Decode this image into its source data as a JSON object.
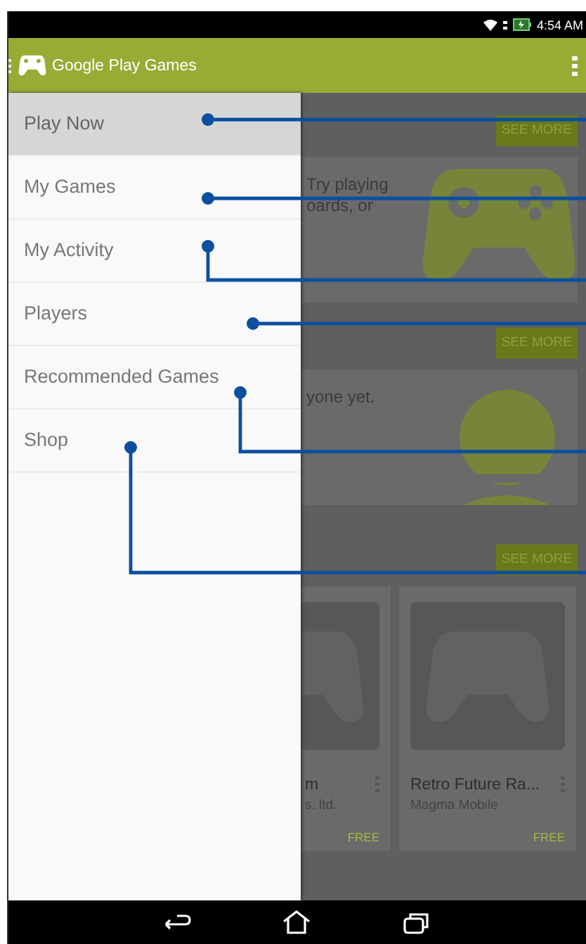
{
  "status_bar": {
    "time": "4:54 AM"
  },
  "toolbar": {
    "title": "Google Play Games"
  },
  "drawer": {
    "items": [
      {
        "label": "Play Now",
        "selected": true
      },
      {
        "label": "My Games",
        "selected": false
      },
      {
        "label": "My Activity",
        "selected": false
      },
      {
        "label": "Players",
        "selected": false
      },
      {
        "label": "Recommended Games",
        "selected": false
      },
      {
        "label": "Shop",
        "selected": false
      }
    ]
  },
  "content": {
    "sections": [
      {
        "kind": "gamepad_card",
        "see_more": "SEE MORE",
        "text": [
          "Try playing",
          "oards, or"
        ]
      },
      {
        "kind": "person_card",
        "see_more": "SEE MORE",
        "text": [
          "yone yet."
        ]
      },
      {
        "kind": "games",
        "see_more": "SEE MORE",
        "games": [
          {
            "title": "m",
            "developer": "s. ltd.",
            "price": "FREE"
          },
          {
            "title": "Retro Future Ra...",
            "developer": "Magma Mobile",
            "price": "FREE"
          }
        ]
      }
    ]
  }
}
